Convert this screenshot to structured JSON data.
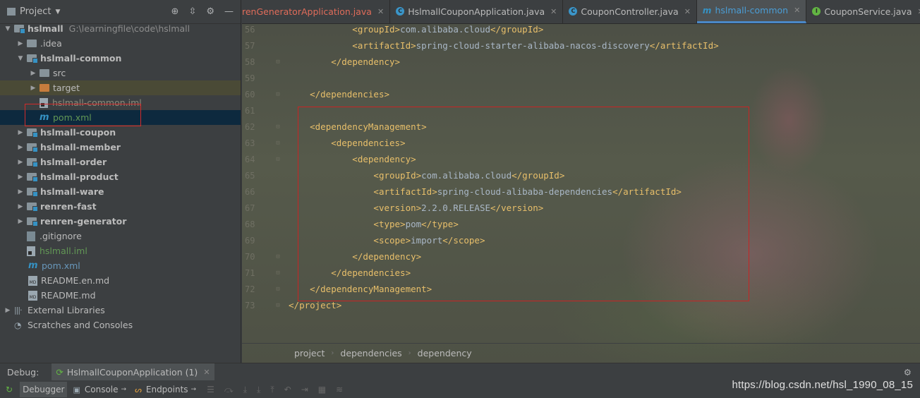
{
  "project_panel": {
    "title": "Project",
    "tree": [
      {
        "label": "hslmall",
        "path": "G:\\learningfile\\code\\hslmall",
        "bold": true
      },
      {
        "label": ".idea"
      },
      {
        "label": "hslmall-common",
        "bold": true
      },
      {
        "label": "src"
      },
      {
        "label": "target"
      },
      {
        "label": "hslmall-common.iml"
      },
      {
        "label": "pom.xml"
      },
      {
        "label": "hslmall-coupon",
        "bold": true
      },
      {
        "label": "hslmall-member",
        "bold": true
      },
      {
        "label": "hslmall-order",
        "bold": true
      },
      {
        "label": "hslmall-product",
        "bold": true
      },
      {
        "label": "hslmall-ware",
        "bold": true
      },
      {
        "label": "renren-fast",
        "bold": true
      },
      {
        "label": "renren-generator",
        "bold": true
      },
      {
        "label": ".gitignore"
      },
      {
        "label": "hslmall.iml"
      },
      {
        "label": "pom.xml"
      },
      {
        "label": "README.en.md"
      },
      {
        "label": "README.md"
      },
      {
        "label": "External Libraries"
      },
      {
        "label": "Scratches and Consoles"
      }
    ]
  },
  "editor": {
    "tabs": [
      {
        "label": "renGeneratorApplication.java"
      },
      {
        "label": "HslmallCouponApplication.java"
      },
      {
        "label": "CouponController.java"
      },
      {
        "label": "hslmall-common"
      },
      {
        "label": "CouponService.java"
      }
    ],
    "lines": [
      {
        "num": "56",
        "indent": 3,
        "tag": "groupId",
        "value": "com.alibaba.cloud"
      },
      {
        "num": "57",
        "indent": 3,
        "tag": "artifactId",
        "value": "spring-cloud-starter-alibaba-nacos-discovery"
      },
      {
        "num": "58",
        "indent": 2,
        "close": "dependency"
      },
      {
        "num": "59"
      },
      {
        "num": "60",
        "indent": 1,
        "close": "dependencies"
      },
      {
        "num": "61"
      },
      {
        "num": "62",
        "indent": 1,
        "open": "dependencyManagement"
      },
      {
        "num": "63",
        "indent": 2,
        "open": "dependencies"
      },
      {
        "num": "64",
        "indent": 3,
        "open": "dependency"
      },
      {
        "num": "65",
        "indent": 4,
        "tag": "groupId",
        "value": "com.alibaba.cloud"
      },
      {
        "num": "66",
        "indent": 4,
        "tag": "artifactId",
        "value": "spring-cloud-alibaba-dependencies"
      },
      {
        "num": "67",
        "indent": 4,
        "tag": "version",
        "value": "2.2.0.RELEASE"
      },
      {
        "num": "68",
        "indent": 4,
        "tag": "type",
        "value": "pom"
      },
      {
        "num": "69",
        "indent": 4,
        "tag": "scope",
        "value": "import"
      },
      {
        "num": "70",
        "indent": 3,
        "close": "dependency"
      },
      {
        "num": "71",
        "indent": 2,
        "close": "dependencies"
      },
      {
        "num": "72",
        "indent": 1,
        "close": "dependencyManagement"
      },
      {
        "num": "73",
        "indent": 0,
        "close": "project"
      }
    ],
    "breadcrumb": [
      "project",
      "dependencies",
      "dependency"
    ]
  },
  "debug": {
    "label": "Debug:",
    "session": "HslmallCouponApplication (1)",
    "tabs": [
      "Debugger",
      "Console",
      "Endpoints"
    ],
    "watermark": "https://blog.csdn.net/hsl_1990_08_15"
  },
  "colors": {
    "tag": "#e8bf6a",
    "text": "#a9b7c6",
    "highlight_box": "#c82424",
    "accent": "#4a88c7"
  }
}
